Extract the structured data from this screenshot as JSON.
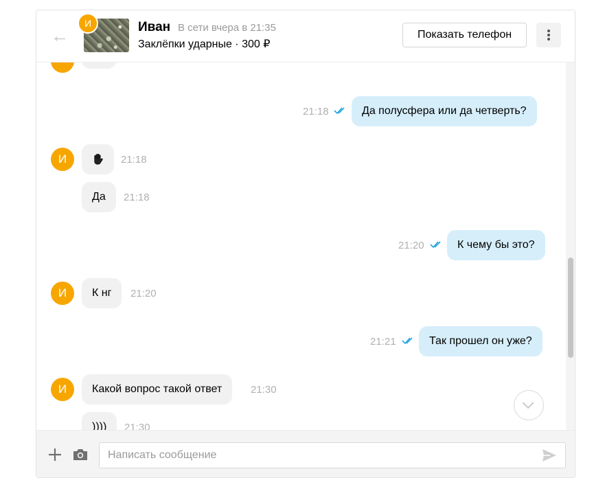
{
  "header": {
    "contact_name": "Иван",
    "contact_status": "В сети вчера в 21:35",
    "avatar_letter": "И",
    "product_line": "Заклёпки ударные · 300 ₽",
    "show_phone_label": "Показать телефон"
  },
  "icons": {
    "back": "arrow-left-icon",
    "more": "vertical-dots-icon",
    "read": "double-check-icon",
    "scroll_down": "chevron-down-icon",
    "attach": "plus-icon",
    "photo": "camera-icon",
    "send": "send-icon"
  },
  "colors": {
    "avatar": "#f7a600",
    "outgoing_bubble": "#d6eefa",
    "incoming_bubble": "#f1f1f1",
    "read_ticks": "#1fa3e0",
    "time": "#b0b0b0"
  },
  "messages": [
    {
      "direction": "out",
      "text": "Да полусфера или да четверть?",
      "time": "21:18",
      "read": true
    },
    {
      "direction": "in",
      "text": "🖐",
      "time": "21:18",
      "avatar": "И"
    },
    {
      "direction": "in",
      "text": "Да",
      "time": "21:18"
    },
    {
      "direction": "out",
      "text": "К чему бы это?",
      "time": "21:20",
      "read": true
    },
    {
      "direction": "in",
      "text": "К нг",
      "time": "21:20",
      "avatar": "И"
    },
    {
      "direction": "out",
      "text": "Так прошел он уже?",
      "time": "21:21",
      "read": true
    },
    {
      "direction": "in",
      "text": "Какой вопрос такой ответ",
      "time": "21:30",
      "avatar": "И"
    },
    {
      "direction": "in",
      "text": "))))",
      "time": "21:30"
    }
  ],
  "composer": {
    "placeholder": "Написать сообщение",
    "value": ""
  }
}
